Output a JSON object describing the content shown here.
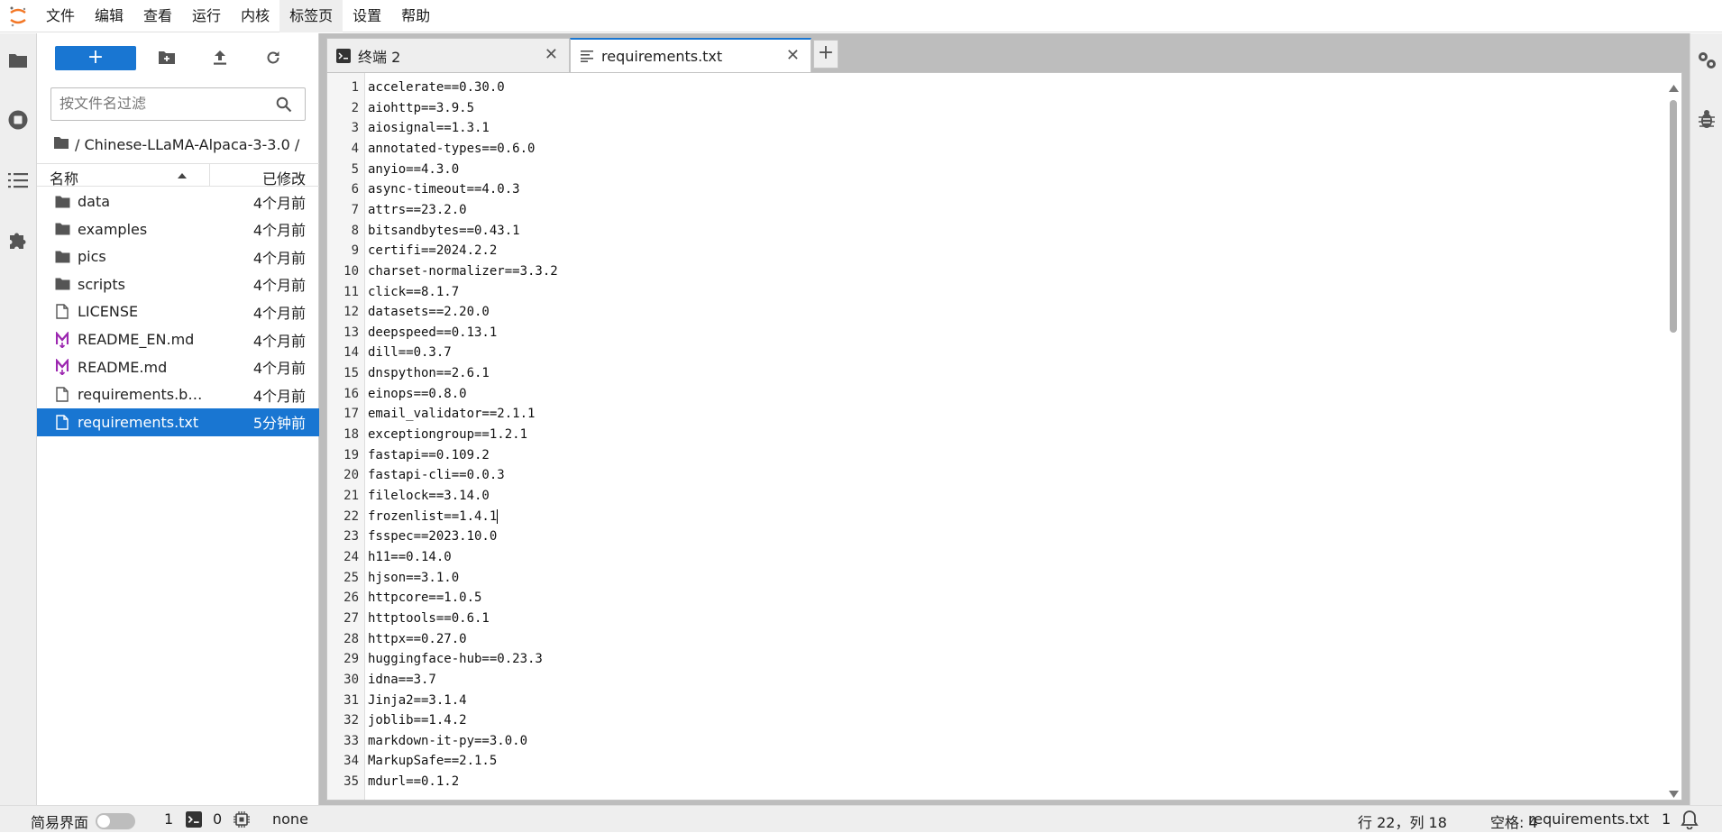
{
  "menubar": {
    "items": [
      "文件",
      "编辑",
      "查看",
      "运行",
      "内核",
      "标签页",
      "设置",
      "帮助"
    ],
    "active_index": 5
  },
  "leftbar": {
    "icons": [
      "folder-icon",
      "running-icon",
      "toc-icon",
      "extension-icon"
    ]
  },
  "filebrowser": {
    "new_label": "+",
    "search_placeholder": "按文件名过滤",
    "breadcrumb": "/ Chinese-LLaMA-Alpaca-3-3.0 /",
    "col_name": "名称",
    "col_modified": "已修改",
    "files": [
      {
        "name": "data",
        "type": "folder",
        "modified": "4个月前"
      },
      {
        "name": "examples",
        "type": "folder",
        "modified": "4个月前"
      },
      {
        "name": "pics",
        "type": "folder",
        "modified": "4个月前"
      },
      {
        "name": "scripts",
        "type": "folder",
        "modified": "4个月前"
      },
      {
        "name": "LICENSE",
        "type": "file",
        "modified": "4个月前"
      },
      {
        "name": "README_EN.md",
        "type": "markdown",
        "modified": "4个月前"
      },
      {
        "name": "README.md",
        "type": "markdown",
        "modified": "4个月前"
      },
      {
        "name": "requirements.bk...",
        "type": "file",
        "modified": "4个月前"
      },
      {
        "name": "requirements.txt",
        "type": "file",
        "modified": "5分钟前",
        "selected": true
      }
    ]
  },
  "tabs": [
    {
      "label": "终端 2",
      "icon": "terminal-icon"
    },
    {
      "label": "requirements.txt",
      "icon": "text-file-icon",
      "current": true
    }
  ],
  "editor": {
    "lines": [
      "accelerate==0.30.0",
      "aiohttp==3.9.5",
      "aiosignal==1.3.1",
      "annotated-types==0.6.0",
      "anyio==4.3.0",
      "async-timeout==4.0.3",
      "attrs==23.2.0",
      "bitsandbytes==0.43.1",
      "certifi==2024.2.2",
      "charset-normalizer==3.3.2",
      "click==8.1.7",
      "datasets==2.20.0",
      "deepspeed==0.13.1",
      "dill==0.3.7",
      "dnspython==2.6.1",
      "einops==0.8.0",
      "email_validator==2.1.1",
      "exceptiongroup==1.2.1",
      "fastapi==0.109.2",
      "fastapi-cli==0.0.3",
      "filelock==3.14.0",
      "frozenlist==1.4.1",
      "fsspec==2023.10.0",
      "h11==0.14.0",
      "hjson==3.1.0",
      "httpcore==1.0.5",
      "httptools==0.6.1",
      "httpx==0.27.0",
      "huggingface-hub==0.23.3",
      "idna==3.7",
      "Jinja2==3.1.4",
      "joblib==1.4.2",
      "markdown-it-py==3.0.0",
      "MarkupSafe==2.1.5",
      "mdurl==0.1.2"
    ]
  },
  "statusbar": {
    "simple_mode": "简易界面",
    "simple_mode_on": false,
    "kernels_count": "1",
    "terminals_count": "0",
    "kernel_status": "none",
    "cursor_pos": "行 22，列 18",
    "indent": "空格: 4",
    "filename": "requirements.txt",
    "notifications": "1"
  },
  "colors": {
    "accent": "#1976d2",
    "markdown_icon": "#9c27b0"
  }
}
